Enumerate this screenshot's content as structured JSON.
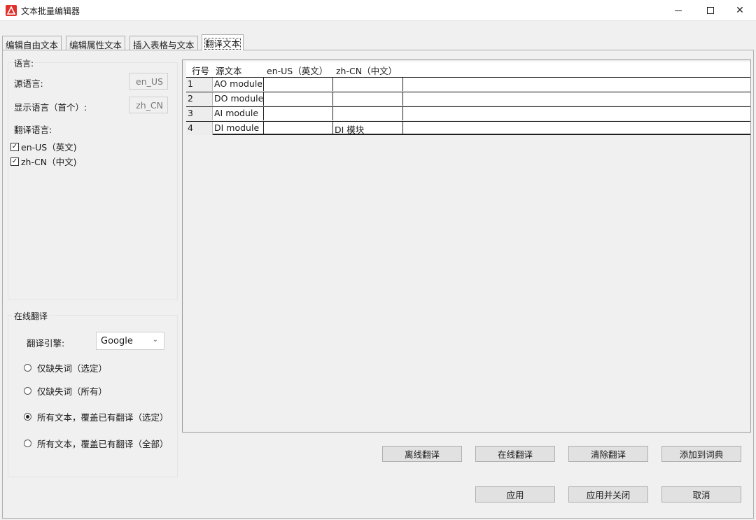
{
  "window": {
    "title": "文本批量编辑器"
  },
  "tabs": [
    {
      "label": "编辑自由文本"
    },
    {
      "label": "编辑属性文本"
    },
    {
      "label": "插入表格与文本"
    },
    {
      "label": "翻译文本"
    }
  ],
  "language": {
    "legend": "语言:",
    "source_label": "源语言:",
    "source_value": "en_US",
    "display_label": "显示语言（首个）:",
    "display_value": "zh_CN",
    "translate_label": "翻译语言:",
    "options": [
      {
        "label": "en-US（英文)",
        "checked": true
      },
      {
        "label": "zh-CN（中文)",
        "checked": true
      }
    ]
  },
  "online": {
    "legend": "在线翻译",
    "engine_label": "翻译引擎:",
    "engine_value": "Google",
    "modes": [
      {
        "label": "仅缺失词（选定）",
        "selected": false
      },
      {
        "label": "仅缺失词（所有）",
        "selected": false
      },
      {
        "label": "所有文本，覆盖已有翻译（选定）",
        "selected": true
      },
      {
        "label": "所有文本，覆盖已有翻译（全部）",
        "selected": false
      }
    ]
  },
  "grid": {
    "headers": [
      "行号",
      "源文本",
      "en-US（英文）",
      "zh-CN（中文）"
    ],
    "rows": [
      [
        "1",
        "AO module",
        "",
        ""
      ],
      [
        "2",
        "DO module",
        "",
        ""
      ],
      [
        "3",
        "AI module",
        "",
        ""
      ],
      [
        "4",
        "DI module",
        "",
        "DI 模块"
      ]
    ]
  },
  "actions": {
    "offline": "离线翻译",
    "online": "在线翻译",
    "clear": "清除翻译",
    "add_dict": "添加到词典",
    "apply": "应用",
    "apply_close": "应用并关闭",
    "cancel": "取消"
  }
}
